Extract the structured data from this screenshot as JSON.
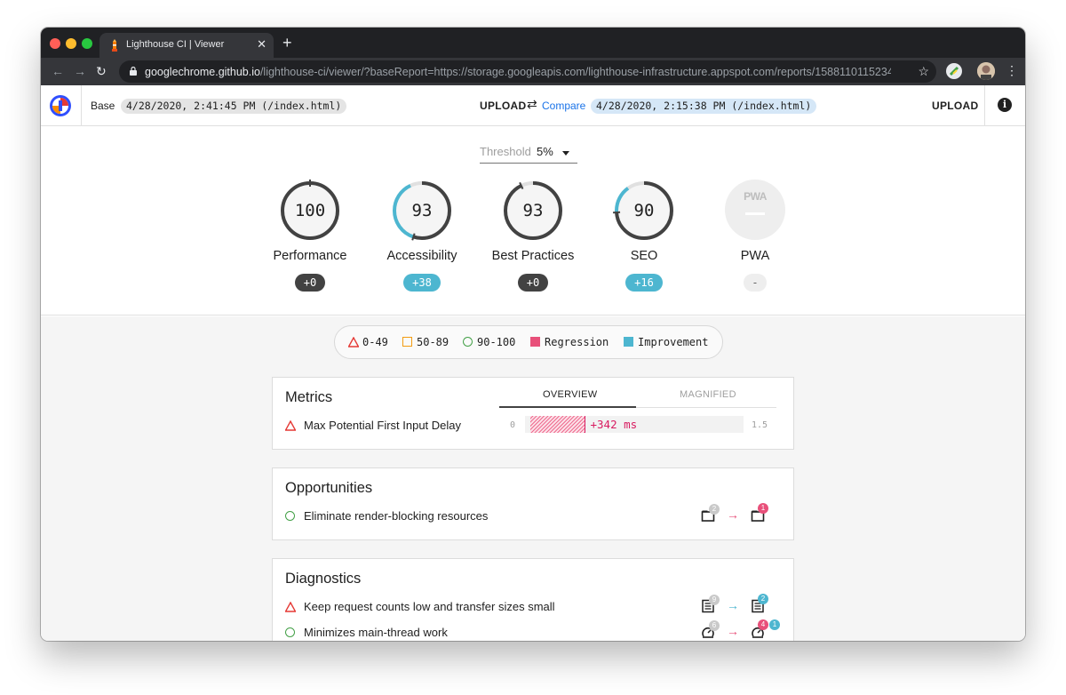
{
  "browser": {
    "tab_title": "Lighthouse CI | Viewer",
    "tab_close": "✕",
    "new_tab": "+",
    "url_host": "googlechrome.github.io",
    "url_path": "/lighthouse-ci/viewer/?baseReport=https://storage.googleapis.com/lighthouse-infrastructure.appspot.com/reports/1588110115234-..."
  },
  "header": {
    "base_label": "Base",
    "base_report": "4/28/2020, 2:41:45 PM (/index.html)",
    "upload_label": "UPLOAD",
    "compare_label": "Compare",
    "compare_report": "4/28/2020, 2:15:38 PM (/index.html)"
  },
  "threshold": {
    "label": "Threshold",
    "value": "5%"
  },
  "categories": [
    {
      "label": "Performance",
      "score": "100",
      "delta": "+0",
      "fraction": 1.0,
      "improved_from": 1.0,
      "color": "#424242"
    },
    {
      "label": "Accessibility",
      "score": "93",
      "delta": "+38",
      "fraction": 0.93,
      "improved_from": 0.55,
      "color": "#4db6d0"
    },
    {
      "label": "Best Practices",
      "score": "93",
      "delta": "+0",
      "fraction": 0.93,
      "improved_from": 0.93,
      "color": "#424242"
    },
    {
      "label": "SEO",
      "score": "90",
      "delta": "+16",
      "fraction": 0.9,
      "improved_from": 0.74,
      "color": "#4db6d0"
    },
    {
      "label": "PWA",
      "score": "PWA",
      "delta": "-"
    }
  ],
  "legend": {
    "fail": "0-49",
    "average": "50-89",
    "pass": "90-100",
    "regression": "Regression",
    "improvement": "Improvement"
  },
  "metrics": {
    "title": "Metrics",
    "tab_overview": "OVERVIEW",
    "tab_magnified": "MAGNIFIED",
    "rows": [
      {
        "label": "Max Potential First Input Delay",
        "scale_min": "0",
        "scale_max": "1.5",
        "delta": "+342 ms",
        "fraction": 0.25
      }
    ]
  },
  "opportunities": {
    "title": "Opportunities",
    "rows": [
      {
        "label": "Eliminate render-blocking resources",
        "base_count": "2",
        "compare_count": "1"
      }
    ]
  },
  "diagnostics": {
    "title": "Diagnostics",
    "rows": [
      {
        "label": "Keep request counts low and transfer sizes small",
        "base_count": "9",
        "compare_count": "2"
      },
      {
        "label": "Minimizes main-thread work",
        "base_count": "6",
        "compare_count": "4",
        "compare_extra": "1"
      }
    ]
  },
  "colors": {
    "regression": "#e8507a",
    "improvement": "#4db6d0",
    "neutral": "#424242",
    "fail": "#e53935",
    "average": "#f39c12",
    "pass": "#43a047"
  }
}
